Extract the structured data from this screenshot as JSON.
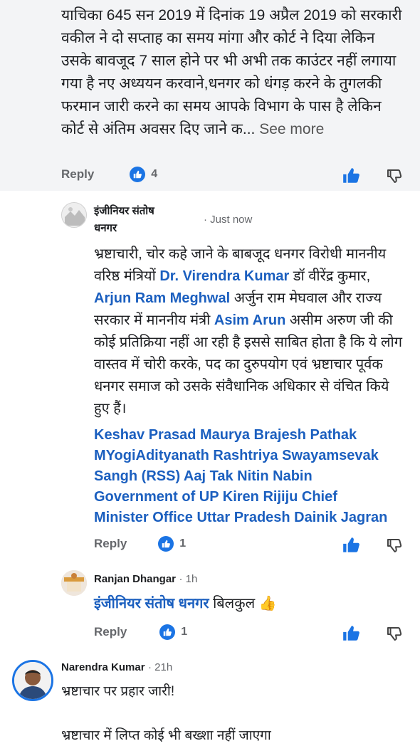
{
  "comment1": {
    "text": "याचिका 645 सन 2019 में दिनांक 19 अप्रैल 2019 को सरकारी वकील ने दो सप्ताह का समय मांगा और कोर्ट ने दिया लेकिन उसके बावजूद 7 साल होने पर भी अभी तक काउंटर नहीं लगाया गया है नए अध्ययन करवाने,धनगर को धंगड़ करने के तुगलकी फरमान जारी करने का समय आपके विभाग के पास है लेकिन कोर्ट से अंतिम अवसर दिए जाने क...",
    "see_more": "See more",
    "reply_label": "Reply",
    "reaction_count": "4"
  },
  "comment2": {
    "author_line1": "इंजीनियर संतोष",
    "author_line2": "धनगर",
    "time": "· Just now",
    "body": {
      "p1": "भ्रष्टाचारी, चोर कहे जाने के बाबजूद धनगर विरोधी माननीय वरिष्ठ मंत्रियों ",
      "m1": "Dr. Virendra Kumar",
      "p2": "  डॉ वीरेंद्र कुमार, ",
      "m2": "Arjun Ram Meghwal",
      "p3": "  अर्जुन राम मेघवाल और राज्य सरकार में माननीय मंत्री ",
      "m3": "Asim Arun",
      "p4": " असीम अरुण जी की कोई प्रतिक्रिया नहीं आ रही है इससे साबित होता है कि ये लोग वास्तव में चोरी करके, पद का दुरुपयोग एवं भ्रष्टाचार पूर्वक धनगर समाज को उसके संवैधानिक अधिकार से वंचित किये हुए हैं।"
    },
    "tags": [
      "Keshav Prasad Maurya Brajesh Pathak",
      "MYogiAdityanath Rashtriya Swayamsevak",
      "Sangh (RSS) Aaj Tak Nitin Nabin",
      "Government of UP Kiren Rijiju Chief",
      "Minister Office Uttar Pradesh Dainik Jagran"
    ],
    "reply_label": "Reply",
    "reaction_count": "1"
  },
  "reply1": {
    "author": "Ranjan Dhangar",
    "time": "· 1h",
    "mention": "इंजीनियर संतोष धनगर",
    "text": " बिलकुल ",
    "emoji": "👍",
    "reply_label": "Reply",
    "reaction_count": "1"
  },
  "comment3": {
    "author": "Narendra Kumar",
    "time": "· 21h",
    "line1": "भ्रष्टाचार पर प्रहार जारी!",
    "line2": "भ्रष्टाचार में लिप्त कोई भी बख्शा नहीं जाएगा"
  },
  "colors": {
    "like_blue": "#1b74e4",
    "mention_blue": "#1b5fbf",
    "highlight_bg": "#f3f4f6"
  }
}
